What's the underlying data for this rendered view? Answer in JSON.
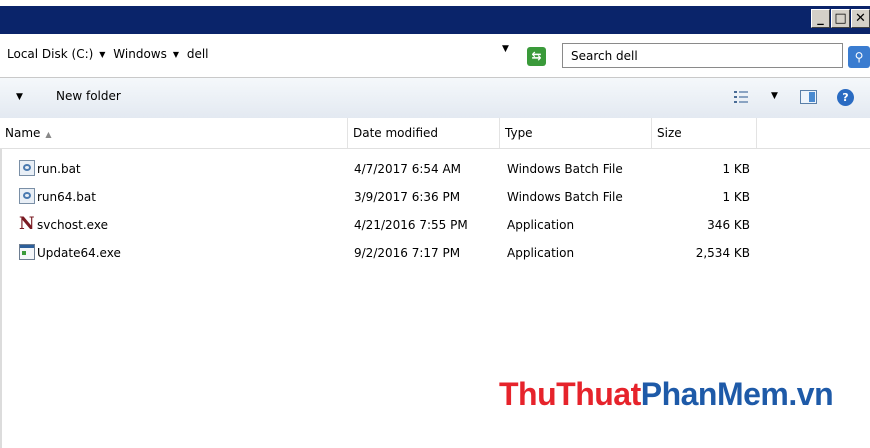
{
  "window": {
    "minimize_label": "_",
    "maximize_label": "□",
    "close_label": "✕"
  },
  "address": {
    "crumbs": [
      "Local Disk (C:)",
      "Windows",
      "dell"
    ],
    "search_placeholder": "Search dell"
  },
  "toolbar": {
    "new_folder_label": "New folder"
  },
  "columns": {
    "name": "Name",
    "date_modified": "Date modified",
    "type": "Type",
    "size": "Size"
  },
  "files": [
    {
      "name": "run.bat",
      "date": "4/7/2017 6:54 AM",
      "type": "Windows Batch File",
      "size": "1 KB",
      "icon": "batch-file-icon"
    },
    {
      "name": "run64.bat",
      "date": "3/9/2017 6:36 PM",
      "type": "Windows Batch File",
      "size": "1 KB",
      "icon": "batch-file-icon"
    },
    {
      "name": "svchost.exe",
      "date": "4/21/2016 7:55 PM",
      "type": "Application",
      "size": "346 KB",
      "icon": "n-app-icon"
    },
    {
      "name": "Update64.exe",
      "date": "9/2/2016 7:17 PM",
      "type": "Application",
      "size": "2,534 KB",
      "icon": "exe-app-icon"
    }
  ],
  "watermark": {
    "part1": "ThuThuat",
    "part2": "PhanMem.vn"
  },
  "colors": {
    "titlebar": "#0a246a",
    "watermark_red": "#e6232b",
    "watermark_blue": "#1e5aa8"
  }
}
